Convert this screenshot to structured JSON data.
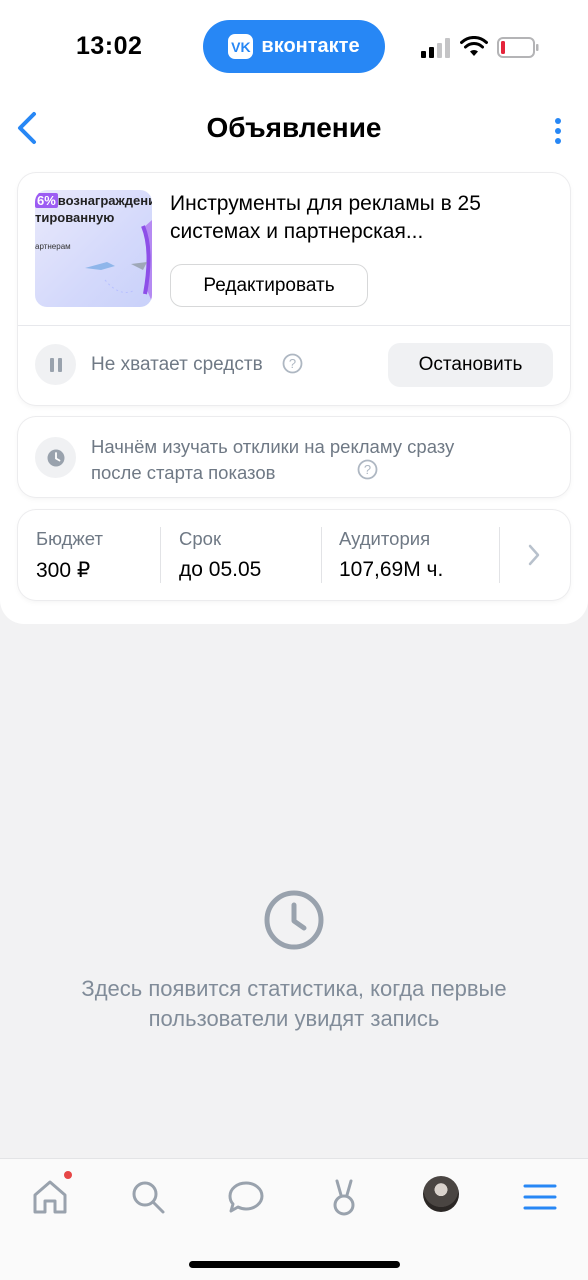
{
  "status_bar": {
    "time": "13:02",
    "app_pill": "вконтакте",
    "vk_logo": "VK"
  },
  "nav": {
    "title": "Объявление",
    "back_icon": "chevron-left-icon",
    "more_icon": "more-vertical-icon"
  },
  "ad": {
    "thumb_badge_pct": "6%",
    "thumb_badge_text": "вознаграждения",
    "thumb_line2": "тированную",
    "thumb_line3": "артнерам",
    "title": "Инструменты для рекламы в 25 системах и партнерская...",
    "edit_label": "Редактировать",
    "status_text": "Не хватает средств",
    "stop_label": "Остановить"
  },
  "info": {
    "text": "Начнём изучать отклики на рекламу сразу после старта показов"
  },
  "stats": [
    {
      "label": "Бюджет",
      "value": "300 ₽"
    },
    {
      "label": "Срок",
      "value": "до 05.05"
    },
    {
      "label": "Аудитория",
      "value": "107,69М ч."
    }
  ],
  "empty_state": {
    "text": "Здесь появится статистика, когда первые пользователи увидят запись"
  },
  "tab_bar": {
    "items": [
      "home-icon",
      "search-icon",
      "messages-icon",
      "clips-icon",
      "profile-avatar",
      "menu-icon"
    ]
  },
  "colors": {
    "accent": "#2787f5",
    "secondary_text": "#6f7985",
    "notification": "#e64646"
  }
}
